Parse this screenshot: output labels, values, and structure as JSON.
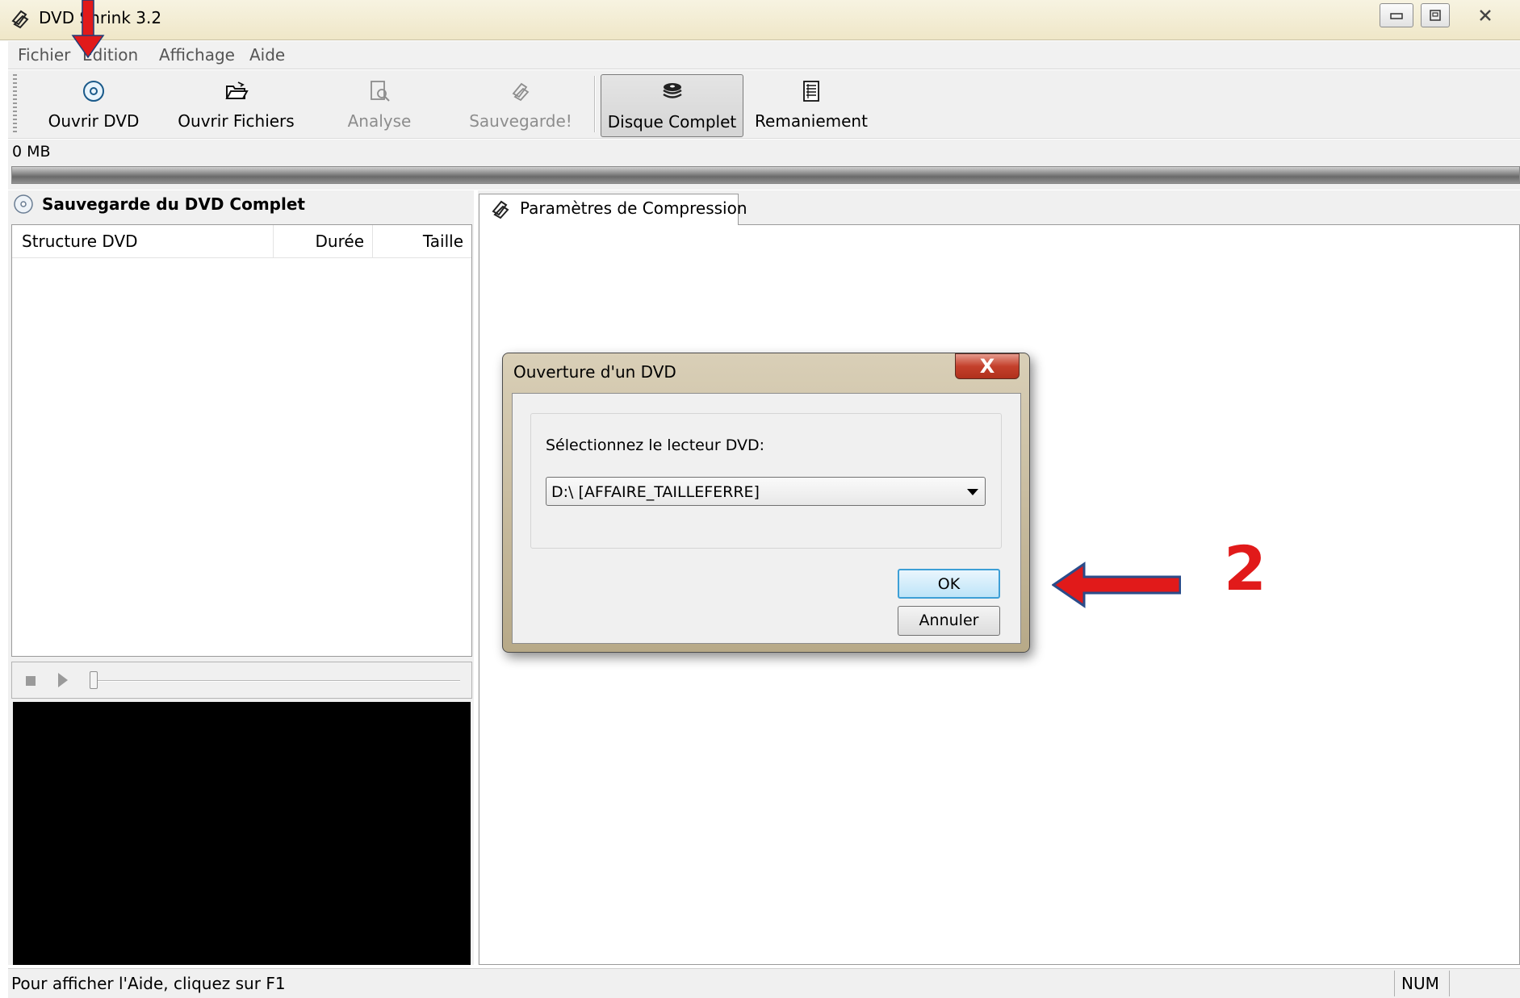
{
  "window": {
    "title": "DVD Shrink 3.2",
    "caption_buttons": [
      "minimize-icon",
      "maximize-icon",
      "close-icon"
    ]
  },
  "menu": {
    "items": [
      "Fichier",
      "Edition",
      "Affichage",
      "Aide"
    ]
  },
  "toolbar": {
    "buttons": [
      {
        "label": "Ouvrir DVD",
        "icon": "dvd-disc-icon",
        "enabled": true
      },
      {
        "label": "Ouvrir Fichiers",
        "icon": "open-folder-icon",
        "enabled": true
      },
      {
        "label": "Analyse",
        "icon": "magnifier-document-icon",
        "enabled": false
      },
      {
        "label": "Sauvegarde!",
        "icon": "shrink-logo-icon",
        "enabled": false
      },
      {
        "label": "Disque Complet",
        "icon": "disc-stack-icon",
        "enabled": true,
        "pressed": true
      },
      {
        "label": "Remaniement",
        "icon": "list-document-icon",
        "enabled": true
      }
    ]
  },
  "size_bar": {
    "label": "0 MB"
  },
  "left_panel": {
    "title": "Sauvegarde du DVD Complet",
    "columns": [
      "Structure DVD",
      "Durée",
      "Taille"
    ],
    "rows": []
  },
  "right_panel": {
    "tab_label": "Paramètres de Compression"
  },
  "status_bar": {
    "text": "Pour afficher l'Aide, cliquez sur F1",
    "num": "NUM"
  },
  "dialog": {
    "title": "Ouverture d'un DVD",
    "close_label": "X",
    "prompt": "Sélectionnez le lecteur DVD:",
    "drive_selected": "D:\\ [AFFAIRE_TAILLEFERRE]",
    "ok_label": "OK",
    "cancel_label": "Annuler"
  },
  "annotations": {
    "step_number": "2",
    "arrow_color": "#e11a1a"
  }
}
